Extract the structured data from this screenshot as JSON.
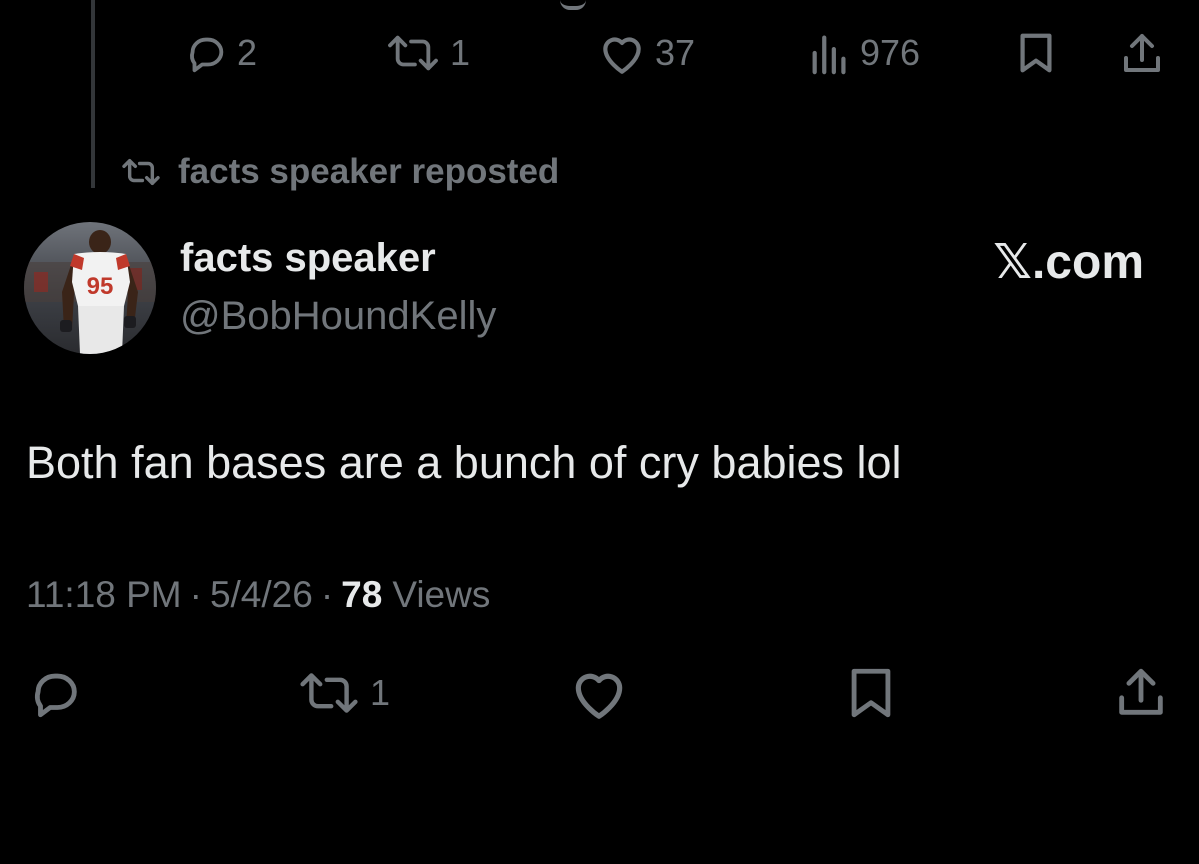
{
  "previous_tweet": {
    "actions": {
      "reply_count": "2",
      "repost_count": "1",
      "like_count": "37",
      "view_count": "976"
    }
  },
  "social_context": {
    "repost_label": "facts speaker reposted"
  },
  "tweet": {
    "author": {
      "display_name": "facts speaker",
      "handle": "@BobHoundKelly"
    },
    "source_label": "𝕏.com",
    "text": "Both fan bases are a bunch of cry babies lol",
    "meta": {
      "time": "11:18 PM",
      "separator": "·",
      "date": "5/4/26",
      "views_count": "78",
      "views_label": "Views"
    },
    "actions": {
      "repost_count": "1"
    }
  },
  "colors": {
    "background": "#000000",
    "primary_text": "#e7e9ea",
    "secondary_text": "#71767b"
  }
}
